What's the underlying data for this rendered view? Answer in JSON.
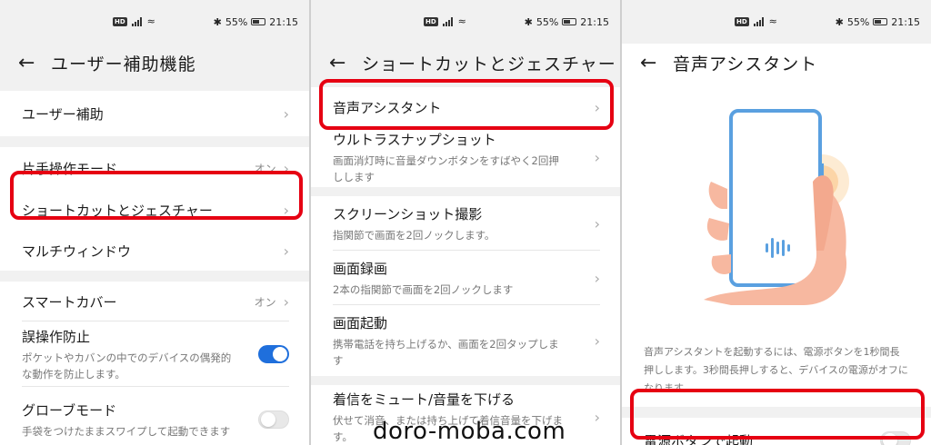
{
  "status": {
    "battery": "55%",
    "time": "21:15",
    "hd": "HD"
  },
  "panel1": {
    "title": "ユーザー補助機能",
    "rows": {
      "accessibility": "ユーザー補助",
      "one_hand": "片手操作モード",
      "one_hand_val": "オン",
      "shortcuts": "ショートカットとジェスチャー",
      "multiwindow": "マルチウィンドウ",
      "smart_cover": "スマートカバー",
      "smart_cover_val": "オン",
      "prevent_mis": "誤操作防止",
      "prevent_mis_sub": "ポケットやカバンの中でのデバイスの偶発的な動作を防止します。",
      "glove": "グローブモード",
      "glove_sub": "手袋をつけたままスワイプして起動できます"
    }
  },
  "panel2": {
    "title": "ショートカットとジェスチャー",
    "rows": {
      "voice": "音声アシスタント",
      "ultra": "ウルトラスナップショット",
      "ultra_sub": "画面消灯時に音量ダウンボタンをすばやく2回押しします",
      "screenshot": "スクリーンショット撮影",
      "screenshot_sub": "指関節で画面を2回ノックします。",
      "record": "画面録画",
      "record_sub": "2本の指関節で画面を2回ノックします",
      "wake": "画面起動",
      "wake_sub": "携帯電話を持ち上げるか、画面を2回タップします",
      "mute": "着信をミュート/音量を下げる",
      "mute_sub": "伏せて消音、または持ち上げて着信音量を下げます。"
    }
  },
  "panel3": {
    "title": "音声アシスタント",
    "desc": "音声アシスタントを起動するには、電源ボタンを1秒間長押しします。3秒間長押しすると、デバイスの電源がオフになります。",
    "power_label": "電源ボタンで起動"
  },
  "watermark": "doro-moba.com",
  "colors": {
    "highlight": "#e60012",
    "toggle_on": "#1f6fdc"
  }
}
